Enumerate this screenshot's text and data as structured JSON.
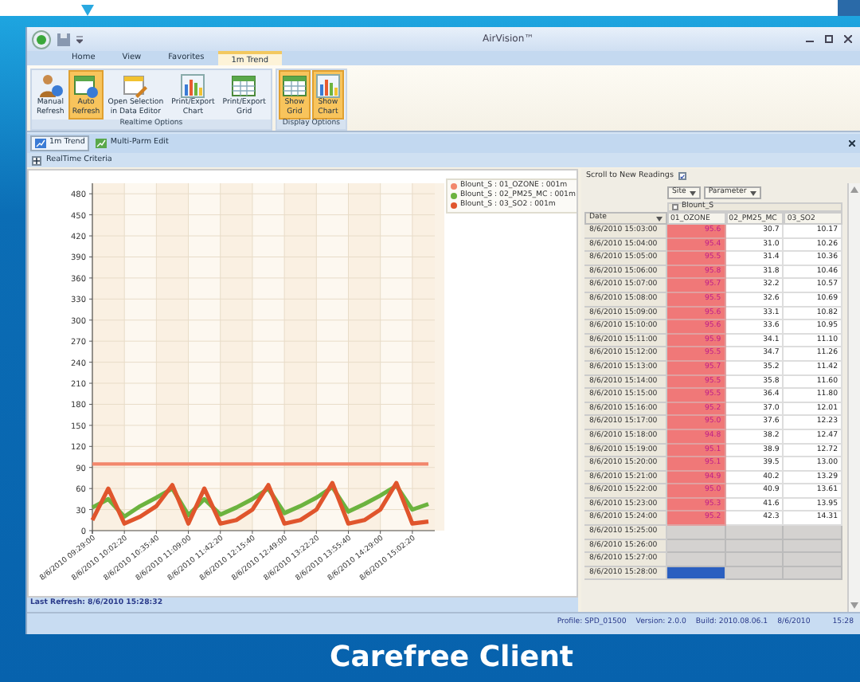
{
  "window": {
    "title": "AirVision™"
  },
  "ribbon_tabs": [
    {
      "label": "Home",
      "selected": false
    },
    {
      "label": "View",
      "selected": false
    },
    {
      "label": "Favorites",
      "selected": false
    },
    {
      "label": "1m Trend",
      "selected": true
    }
  ],
  "ribbon_groups": [
    {
      "label": "Realtime Options",
      "buttons": [
        {
          "kind": "person",
          "lines": [
            "Manual",
            "Refresh"
          ],
          "on": false
        },
        {
          "kind": "auto",
          "lines": [
            "Auto",
            "Refresh"
          ],
          "on": true
        },
        {
          "kind": "editor",
          "lines": [
            "Open Selection",
            "in Data Editor"
          ],
          "on": false
        },
        {
          "kind": "chart",
          "lines": [
            "Print/Export",
            "Chart"
          ],
          "on": false
        },
        {
          "kind": "grid",
          "lines": [
            "Print/Export",
            "Grid"
          ],
          "on": false
        }
      ]
    },
    {
      "label": "Display Options",
      "buttons": [
        {
          "kind": "grid",
          "lines": [
            "Show",
            "Grid"
          ],
          "on": true
        },
        {
          "kind": "chart",
          "lines": [
            "Show",
            "Chart"
          ],
          "on": true
        }
      ]
    }
  ],
  "doc_tabs": [
    {
      "label": "1m Trend",
      "selected": true
    },
    {
      "label": "Multi-Parm Edit",
      "selected": false
    }
  ],
  "criteria": {
    "label": "RealTime Criteria",
    "expanded": false
  },
  "chart": {
    "chart_data": {
      "type": "line",
      "grid": true,
      "legend": "top-right",
      "ylim": [
        0,
        495
      ],
      "yticks": [
        0,
        30,
        60,
        90,
        120,
        150,
        180,
        210,
        240,
        270,
        300,
        330,
        360,
        390,
        420,
        450,
        480
      ],
      "categories": [
        "8/6/2010 09:29:00",
        null,
        "8/6/2010 10:02:20",
        null,
        "8/6/2010 10:35:40",
        null,
        "8/6/2010 11:09:00",
        null,
        "8/6/2010 11:42:20",
        null,
        "8/6/2010 12:15:40",
        null,
        "8/6/2010 12:49:00",
        null,
        "8/6/2010 13:22:20",
        null,
        "8/6/2010 13:55:40",
        null,
        "8/6/2010 14:29:00",
        null,
        "8/6/2010 15:02:20",
        null
      ],
      "series": [
        {
          "name": "Blount_S : 01_OZONE : 001m",
          "color": "#f2876c",
          "values": [
            95,
            95,
            95,
            95,
            95,
            95,
            95,
            95,
            95,
            95,
            95,
            95,
            95,
            95,
            95,
            95,
            95,
            95,
            95,
            95,
            95,
            95
          ]
        },
        {
          "name": "Blount_S : 02_PM25_MC : 001m",
          "color": "#6cb33f",
          "values": [
            33,
            45,
            20,
            35,
            47,
            60,
            22,
            45,
            23,
            33,
            45,
            60,
            25,
            35,
            47,
            62,
            27,
            38,
            50,
            64,
            30,
            38
          ]
        },
        {
          "name": "Blount_S : 03_SO2 : 001m",
          "color": "#e0552c",
          "values": [
            15,
            60,
            10,
            20,
            35,
            65,
            10,
            60,
            10,
            15,
            30,
            65,
            10,
            15,
            30,
            68,
            10,
            15,
            30,
            68,
            10,
            13
          ]
        }
      ]
    }
  },
  "grid": {
    "scroll_to_new": {
      "label": "Scroll to New Readings",
      "checked": true
    },
    "filters": [
      "Site",
      "Parameter"
    ],
    "site": "Blount_S",
    "date_column": "Date",
    "columns": [
      {
        "label": "01_OZONE",
        "highlighted": true
      },
      {
        "label": "02_PM25_MC",
        "highlighted": false
      },
      {
        "label": "03_SO2",
        "highlighted": false
      }
    ],
    "rows": [
      {
        "date": "8/6/2010 15:03:00",
        "values": [
          "95.6",
          "30.7",
          "10.17"
        ],
        "selected": false
      },
      {
        "date": "8/6/2010 15:04:00",
        "values": [
          "95.4",
          "31.0",
          "10.26"
        ],
        "selected": false
      },
      {
        "date": "8/6/2010 15:05:00",
        "values": [
          "95.5",
          "31.4",
          "10.36"
        ],
        "selected": false
      },
      {
        "date": "8/6/2010 15:06:00",
        "values": [
          "95.8",
          "31.8",
          "10.46"
        ],
        "selected": false
      },
      {
        "date": "8/6/2010 15:07:00",
        "values": [
          "95.7",
          "32.2",
          "10.57"
        ],
        "selected": false
      },
      {
        "date": "8/6/2010 15:08:00",
        "values": [
          "95.5",
          "32.6",
          "10.69"
        ],
        "selected": false
      },
      {
        "date": "8/6/2010 15:09:00",
        "values": [
          "95.6",
          "33.1",
          "10.82"
        ],
        "selected": false
      },
      {
        "date": "8/6/2010 15:10:00",
        "values": [
          "95.6",
          "33.6",
          "10.95"
        ],
        "selected": false
      },
      {
        "date": "8/6/2010 15:11:00",
        "values": [
          "95.9",
          "34.1",
          "11.10"
        ],
        "selected": false
      },
      {
        "date": "8/6/2010 15:12:00",
        "values": [
          "95.5",
          "34.7",
          "11.26"
        ],
        "selected": false
      },
      {
        "date": "8/6/2010 15:13:00",
        "values": [
          "95.7",
          "35.2",
          "11.42"
        ],
        "selected": false
      },
      {
        "date": "8/6/2010 15:14:00",
        "values": [
          "95.5",
          "35.8",
          "11.60"
        ],
        "selected": false
      },
      {
        "date": "8/6/2010 15:15:00",
        "values": [
          "95.5",
          "36.4",
          "11.80"
        ],
        "selected": false
      },
      {
        "date": "8/6/2010 15:16:00",
        "values": [
          "95.2",
          "37.0",
          "12.01"
        ],
        "selected": false
      },
      {
        "date": "8/6/2010 15:17:00",
        "values": [
          "95.0",
          "37.6",
          "12.23"
        ],
        "selected": false
      },
      {
        "date": "8/6/2010 15:18:00",
        "values": [
          "94.8",
          "38.2",
          "12.47"
        ],
        "selected": false
      },
      {
        "date": "8/6/2010 15:19:00",
        "values": [
          "95.1",
          "38.9",
          "12.72"
        ],
        "selected": false
      },
      {
        "date": "8/6/2010 15:20:00",
        "values": [
          "95.1",
          "39.5",
          "13.00"
        ],
        "selected": false
      },
      {
        "date": "8/6/2010 15:21:00",
        "values": [
          "94.9",
          "40.2",
          "13.29"
        ],
        "selected": false
      },
      {
        "date": "8/6/2010 15:22:00",
        "values": [
          "95.0",
          "40.9",
          "13.61"
        ],
        "selected": false
      },
      {
        "date": "8/6/2010 15:23:00",
        "values": [
          "95.3",
          "41.6",
          "13.95"
        ],
        "selected": false
      },
      {
        "date": "8/6/2010 15:24:00",
        "values": [
          "95.2",
          "42.3",
          "14.31"
        ],
        "selected": false
      },
      {
        "date": "8/6/2010 15:25:00",
        "selected": false
      },
      {
        "date": "8/6/2010 15:26:00",
        "selected": false
      },
      {
        "date": "8/6/2010 15:27:00",
        "selected": false
      },
      {
        "date": "8/6/2010 15:28:00",
        "selected": true
      }
    ]
  },
  "status": {
    "last_refresh": "Last Refresh: 8/6/2010 15:28:32",
    "profile": "Profile: SPD_01500",
    "version": "Version: 2.0.0",
    "build": "Build: 2010.08.06.1",
    "date": "8/6/2010",
    "time": "15:28"
  },
  "caption": "Carefree Client"
}
